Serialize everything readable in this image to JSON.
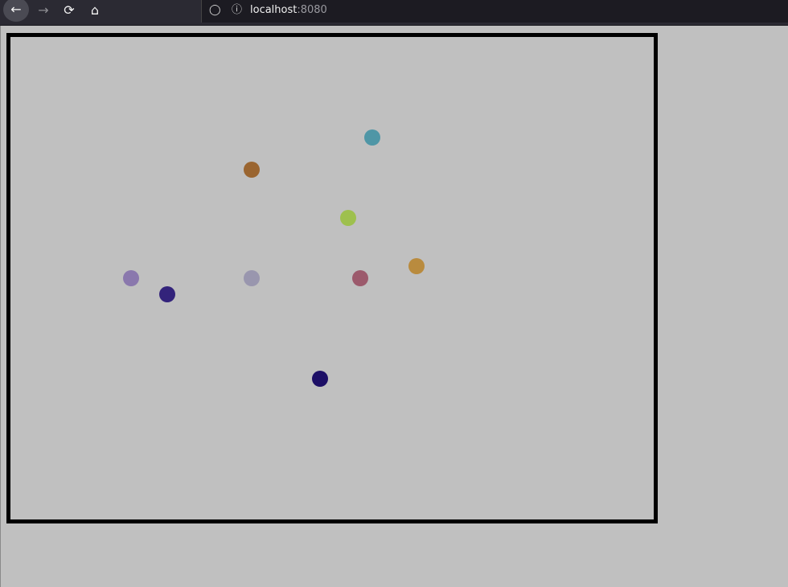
{
  "browser": {
    "url_host": "localhost",
    "url_port": ":8080",
    "icons": {
      "back": "arrow-left-icon",
      "forward": "arrow-right-icon",
      "reload": "reload-icon",
      "home": "home-icon",
      "shield": "shield-icon",
      "info": "info-icon"
    }
  },
  "canvas": {
    "background": "#c0c0c0",
    "border_color": "#000000",
    "balls": [
      {
        "id": "ball-teal",
        "color": "#4f96a6"
      },
      {
        "id": "ball-brown",
        "color": "#9a6530"
      },
      {
        "id": "ball-lime",
        "color": "#9ec04e"
      },
      {
        "id": "ball-gold",
        "color": "#b98b3e"
      },
      {
        "id": "ball-lavender",
        "color": "#8a78ad"
      },
      {
        "id": "ball-indigo",
        "color": "#33237b"
      },
      {
        "id": "ball-grey-violet",
        "color": "#9996ae"
      },
      {
        "id": "ball-rose",
        "color": "#9c5a6c"
      },
      {
        "id": "ball-navy",
        "color": "#1d0f66"
      }
    ]
  }
}
